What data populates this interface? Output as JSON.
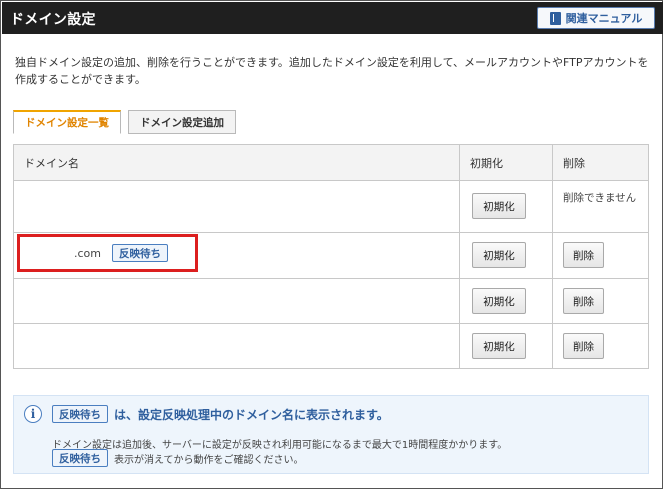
{
  "header": {
    "title": "ドメイン設定",
    "manual_label": "関連マニュアル"
  },
  "description": "独自ドメイン設定の追加、削除を行うことができます。追加したドメイン設定を利用して、メールアカウントやFTPアカウントを作成することができます。",
  "tabs": [
    {
      "label": "ドメイン設定一覧",
      "active": true
    },
    {
      "label": "ドメイン設定追加",
      "active": false
    }
  ],
  "table": {
    "headers": [
      "ドメイン名",
      "初期化",
      "削除"
    ],
    "rows": [
      {
        "domain": "",
        "badge": "",
        "init_label": "初期化",
        "delete_label": "",
        "delete_note": "削除できません"
      },
      {
        "domain": ".com",
        "badge": "反映待ち",
        "init_label": "初期化",
        "delete_label": "削除",
        "delete_note": ""
      },
      {
        "domain": "",
        "badge": "",
        "init_label": "初期化",
        "delete_label": "削除",
        "delete_note": ""
      },
      {
        "domain": "",
        "badge": "",
        "init_label": "初期化",
        "delete_label": "削除",
        "delete_note": ""
      }
    ]
  },
  "info": {
    "icon": "i",
    "badge": "反映待ち",
    "main_text": "は、設定反映処理中のドメイン名に表示されます。",
    "sub_text1": "ドメイン設定は追加後、サーバーに設定が反映され利用可能になるまで最大で1時間程度かかります。",
    "sub_badge": "反映待ち",
    "sub_text2": "表示が消えてから動作をご確認ください。"
  },
  "colors": {
    "header_bg": "#1f1f1f",
    "accent_blue": "#2f5f9e",
    "active_tab": "#e08400",
    "highlight": "#dc1f1f",
    "info_bg": "#eef5fc"
  }
}
